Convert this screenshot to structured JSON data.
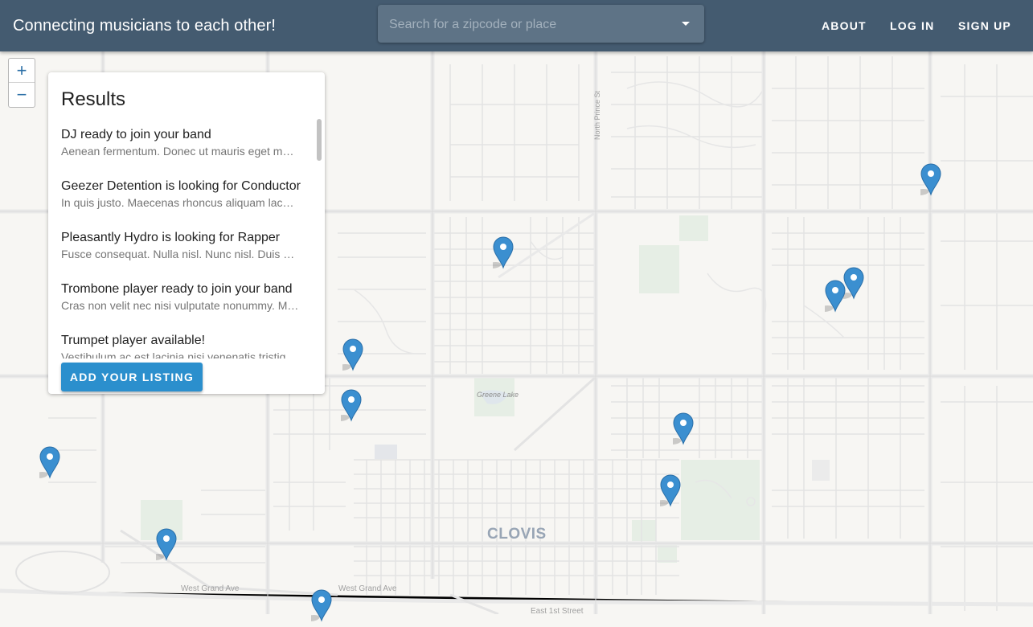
{
  "header": {
    "title": "Connecting musicians to each other!",
    "search_placeholder": "Search for a zipcode or place",
    "search_value": "",
    "nav": [
      "ABOUT",
      "LOG IN",
      "SIGN UP"
    ]
  },
  "map": {
    "zoom_in": "+",
    "zoom_out": "−",
    "labels": {
      "city": "CLOVIS",
      "lake": "Greene Lake",
      "street_prince": "North Prince St",
      "street_grand_1": "West Grand Ave",
      "street_grand_2": "West Grand Ave",
      "street_first": "East 1st Street"
    },
    "marker_color": "#3b8fd0"
  },
  "results": {
    "title": "Results",
    "items": [
      {
        "title": "DJ ready to join your band",
        "desc": "Aenean fermentum. Donec ut mauris eget massa tempor convallis."
      },
      {
        "title": "Geezer Detention is looking for Conductor",
        "desc": "In quis justo. Maecenas rhoncus aliquam lacus. Morbi quis tortor."
      },
      {
        "title": "Pleasantly Hydro is looking for Rapper",
        "desc": "Fusce consequat. Nulla nisl. Nunc nisl. Duis bibendum, felis sed."
      },
      {
        "title": "Trombone player ready to join your band",
        "desc": "Cras non velit nec nisi vulputate nonummy. Maecenas tincidunt."
      },
      {
        "title": "Trumpet player available!",
        "desc": "Vestibulum ac est lacinia nisi venenatis tristique. Fusce congue."
      }
    ],
    "add_button": "ADD YOUR LISTING"
  },
  "colors": {
    "appbar": "#445b70",
    "accent": "#2b8fcd",
    "map_background": "#f7f6f3",
    "park": "#e6eee5"
  }
}
